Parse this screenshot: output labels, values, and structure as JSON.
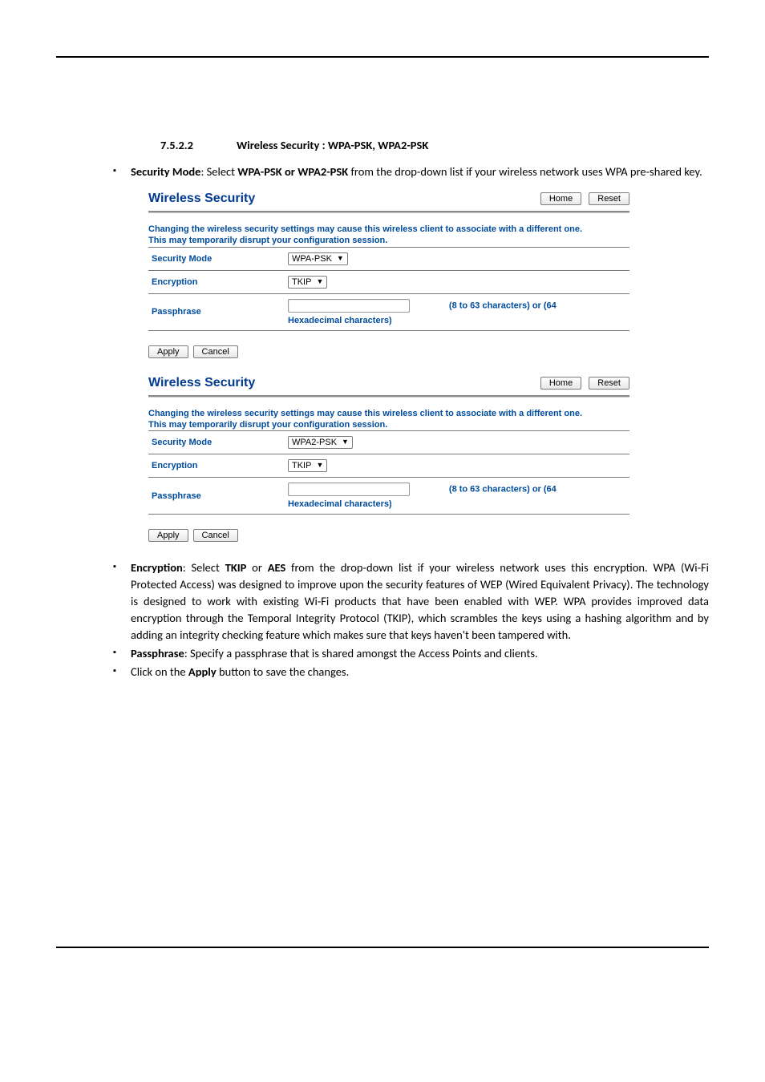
{
  "section": {
    "number": "7.5.2.2",
    "title": "Wireless Security : WPA-PSK, WPA2-PSK"
  },
  "bullets": {
    "sec_mode": {
      "label": "Security Mode",
      "text_before": ": Select ",
      "option_bold": "WPA-PSK or WPA2-PSK",
      "text_after": " from the drop-down list if your wireless network uses WPA pre-shared key."
    },
    "encryption": {
      "label": "Encryption",
      "text_before": ": Select ",
      "opt1": "TKIP",
      "mid": " or ",
      "opt2": "AES",
      "text_after": " from the drop-down list if your wireless network uses this encryption. WPA (Wi-Fi Protected Access) was designed to improve upon the security features of WEP (Wired Equivalent Privacy). The technology is designed to work with existing Wi-Fi products that have been enabled with WEP. WPA provides improved data encryption through the Temporal Integrity Protocol (TKIP), which scrambles the keys using a hashing algorithm and by adding an integrity checking feature which makes sure that keys haven't been tampered with."
    },
    "passphrase": {
      "label": "Passphrase",
      "text": ": Specify a passphrase that is shared amongst the Access Points and clients."
    },
    "apply": {
      "text_before": "Click on the ",
      "label": "Apply",
      "text_after": " button to save the changes."
    }
  },
  "panel": {
    "title": "Wireless Security",
    "home": "Home",
    "reset": "Reset",
    "warn1": "Changing the wireless security settings may cause this wireless client to associate with a different one.",
    "warn2": "This may temporarily disrupt your configuration session.",
    "rows": {
      "secmode_label": "Security Mode",
      "enc_label": "Encryption",
      "pass_label": "Passphrase",
      "pass_hint1": "(8 to 63 characters) or (64",
      "pass_hint2": "Hexadecimal characters)"
    },
    "select_wpa": "WPA-PSK",
    "select_wpa2": "WPA2-PSK",
    "select_tkip": "TKIP",
    "apply": "Apply",
    "cancel": "Cancel"
  }
}
